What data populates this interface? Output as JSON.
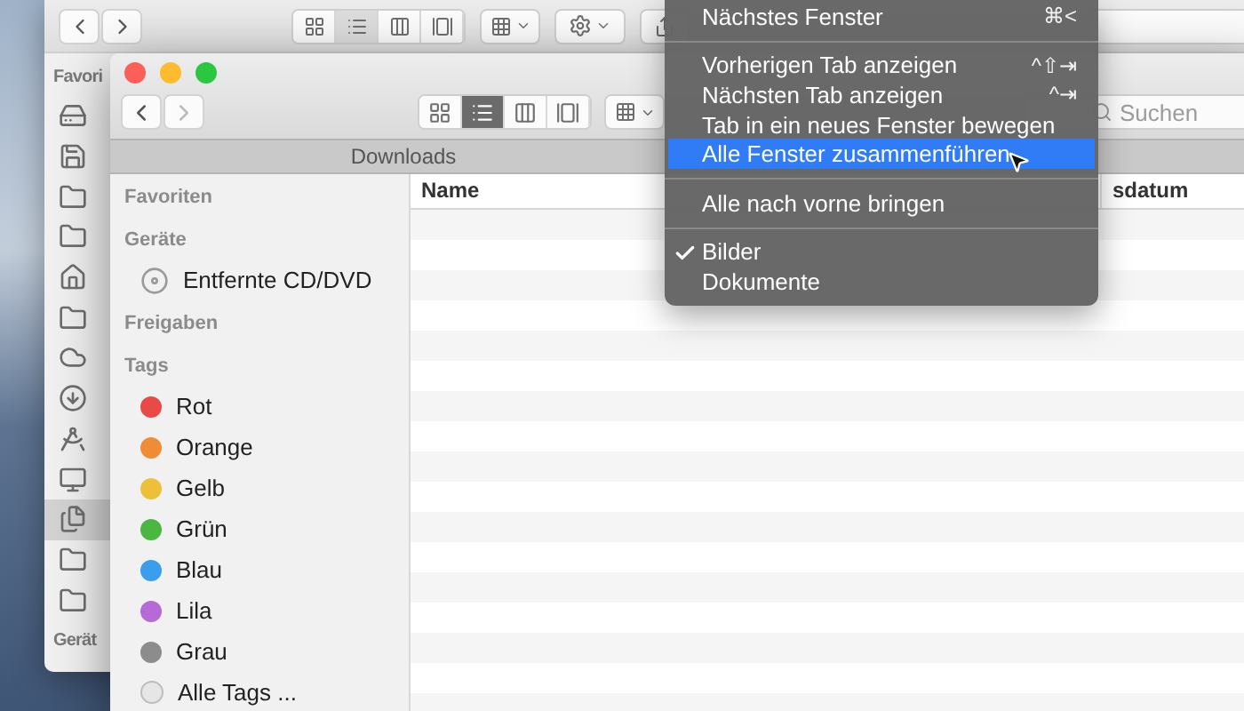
{
  "back_window": {
    "sidebar_heading": "Favori",
    "view_modes": [
      {
        "kind": "icons",
        "selected": false
      },
      {
        "kind": "list",
        "selected": true
      },
      {
        "kind": "columns",
        "selected": false
      },
      {
        "kind": "gallery",
        "selected": false
      }
    ],
    "sidebar_icons": [
      {
        "kind": "drive",
        "selected": false
      },
      {
        "kind": "disk",
        "selected": false
      },
      {
        "kind": "folder",
        "selected": false
      },
      {
        "kind": "folder",
        "selected": false
      },
      {
        "kind": "home",
        "selected": false
      },
      {
        "kind": "folder",
        "selected": false
      },
      {
        "kind": "cloud",
        "selected": false
      },
      {
        "kind": "download",
        "selected": false
      },
      {
        "kind": "apps",
        "selected": false
      },
      {
        "kind": "display",
        "selected": false
      },
      {
        "kind": "documents",
        "selected": true
      },
      {
        "kind": "folder",
        "selected": false
      },
      {
        "kind": "folder",
        "selected": false
      }
    ],
    "bottom_heading": "Gerät"
  },
  "front_window": {
    "tab": "Downloads",
    "search": {
      "placeholder": "Suchen"
    },
    "view_modes": [
      {
        "kind": "icons",
        "selected": false
      },
      {
        "kind": "list",
        "selected": true
      },
      {
        "kind": "columns",
        "selected": false
      },
      {
        "kind": "gallery",
        "selected": false
      }
    ],
    "sidebar": [
      {
        "heading": "Favoriten"
      },
      {
        "heading": "Geräte",
        "items": [
          {
            "kind": "disc",
            "label": "Entfernte CD/DVD"
          }
        ]
      },
      {
        "heading": "Freigaben"
      },
      {
        "heading": "Tags",
        "items": [
          {
            "kind": "tag",
            "label": "Rot",
            "color": "#e94a46"
          },
          {
            "kind": "tag",
            "label": "Orange",
            "color": "#ef8c35"
          },
          {
            "kind": "tag",
            "label": "Gelb",
            "color": "#eec03a"
          },
          {
            "kind": "tag",
            "label": "Grün",
            "color": "#4bb640"
          },
          {
            "kind": "tag",
            "label": "Blau",
            "color": "#3a9ded"
          },
          {
            "kind": "tag",
            "label": "Lila",
            "color": "#b66ad8"
          },
          {
            "kind": "tag",
            "label": "Grau",
            "color": "#8c8c8c"
          },
          {
            "kind": "all",
            "label": "Alle Tags ..."
          }
        ]
      }
    ],
    "columns": [
      "Name",
      "sdatum"
    ]
  },
  "menu": {
    "items": [
      {
        "kind": "item",
        "label": "Nächstes Fenster",
        "shortcut": "⌘<",
        "selected": false,
        "checked": false
      },
      {
        "kind": "separator"
      },
      {
        "kind": "item",
        "label": "Vorherigen Tab anzeigen",
        "shortcut": "^⇧⇥",
        "selected": false,
        "checked": false
      },
      {
        "kind": "item",
        "label": "Nächsten Tab anzeigen",
        "shortcut": "^⇥",
        "selected": false,
        "checked": false
      },
      {
        "kind": "item",
        "label": "Tab in ein neues Fenster bewegen",
        "selected": false,
        "checked": false
      },
      {
        "kind": "item",
        "label": "Alle Fenster zusammenführen",
        "selected": true,
        "checked": false
      },
      {
        "kind": "separator"
      },
      {
        "kind": "item",
        "label": "Alle nach vorne bringen",
        "selected": false,
        "checked": false
      },
      {
        "kind": "separator"
      },
      {
        "kind": "item",
        "label": "Bilder",
        "selected": false,
        "checked": true
      },
      {
        "kind": "item",
        "label": "Dokumente",
        "selected": false,
        "checked": false
      }
    ]
  }
}
